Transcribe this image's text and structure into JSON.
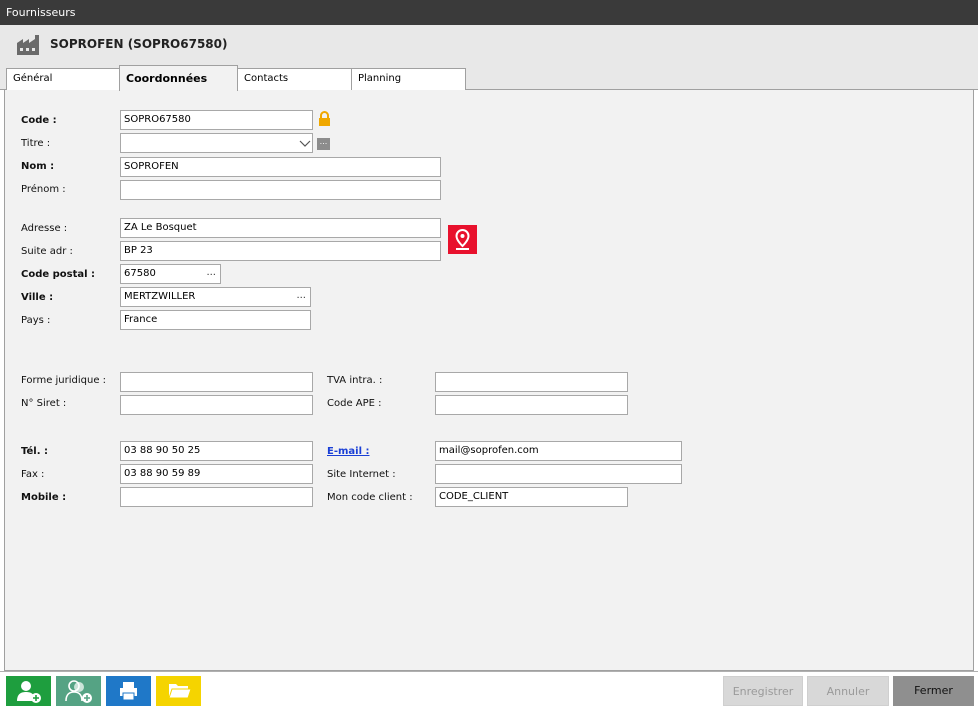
{
  "window": {
    "title": "Fournisseurs"
  },
  "header": {
    "title": "SOPROFEN (SOPRO67580)",
    "icon": "factory-icon"
  },
  "tabs": [
    {
      "label": "Général",
      "active": false
    },
    {
      "label": "Coordonnées",
      "active": true
    },
    {
      "label": "Contacts",
      "active": false
    },
    {
      "label": "Planning",
      "active": false
    }
  ],
  "form": {
    "code": {
      "label": "Code :",
      "value": "SOPRO67580"
    },
    "titre": {
      "label": "Titre :",
      "value": "",
      "more": "..."
    },
    "nom": {
      "label": "Nom :",
      "value": "SOPROFEN"
    },
    "prenom": {
      "label": "Prénom :",
      "value": ""
    },
    "adresse": {
      "label": "Adresse :",
      "value": "ZA Le Bosquet"
    },
    "suite_adr": {
      "label": "Suite adr :",
      "value": "BP 23"
    },
    "code_postal": {
      "label": "Code postal :",
      "value": "67580",
      "more": "..."
    },
    "ville": {
      "label": "Ville :",
      "value": "MERTZWILLER",
      "more": "..."
    },
    "pays": {
      "label": "Pays :",
      "value": "France"
    },
    "forme_juridique": {
      "label": "Forme juridique :",
      "value": ""
    },
    "siret": {
      "label": "N° Siret :",
      "value": ""
    },
    "tva_intra": {
      "label": "TVA intra. :",
      "value": ""
    },
    "code_ape": {
      "label": "Code APE :",
      "value": ""
    },
    "tel": {
      "label": "Tél. :",
      "value": "03 88 90 50 25"
    },
    "fax": {
      "label": "Fax :",
      "value": "03 88 90 59 89"
    },
    "mobile": {
      "label": "Mobile :",
      "value": ""
    },
    "email": {
      "label": "E-mail :",
      "value": "mail@soprofen.com"
    },
    "site_internet": {
      "label": "Site Internet :",
      "value": ""
    },
    "mon_code_client": {
      "label": "Mon code client :",
      "value": "CODE_CLIENT"
    }
  },
  "footer": {
    "icons": [
      "add-contact-icon",
      "add-contact-alt-icon",
      "print-icon",
      "folder-icon"
    ],
    "enregistrer": "Enregistrer",
    "annuler": "Annuler",
    "fermer": "Fermer"
  },
  "colors": {
    "accent_green": "#1e9e3e",
    "accent_teal": "#55a384",
    "accent_blue": "#1f78c8",
    "accent_yellow": "#f5d400",
    "map_pin_red": "#e8112d",
    "lock_orange": "#f0a800"
  }
}
